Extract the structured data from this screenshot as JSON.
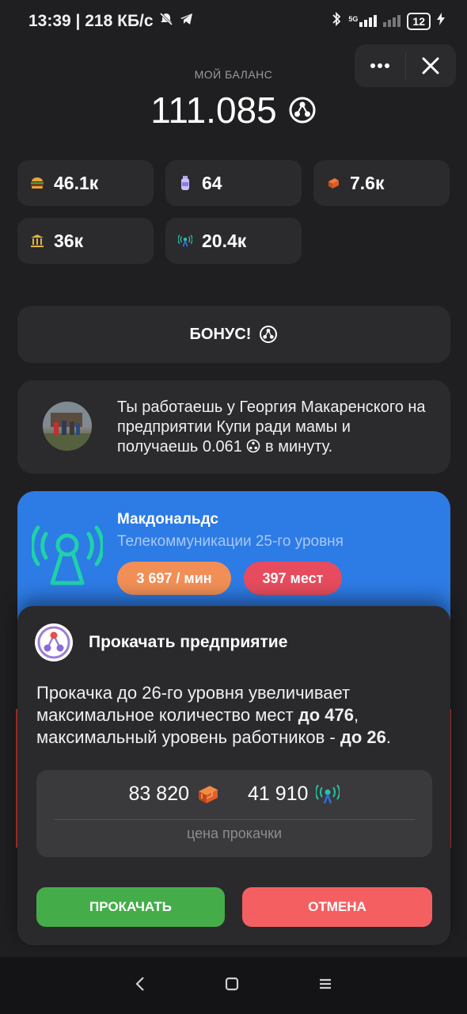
{
  "status_bar": {
    "time_speed": "13:39 | 218 КБ/с",
    "network": "5G",
    "battery": "12"
  },
  "balance": {
    "label": "МОЙ БАЛАНС",
    "value": "111.085"
  },
  "resources": [
    {
      "icon": "burger-icon",
      "value": "46.1к"
    },
    {
      "icon": "bottle-icon",
      "value": "64"
    },
    {
      "icon": "brick-icon",
      "value": "7.6к"
    },
    {
      "icon": "bank-icon",
      "value": "36к"
    },
    {
      "icon": "antenna-icon",
      "value": "20.4к"
    }
  ],
  "bonus": {
    "label": "БОНУС!"
  },
  "work": {
    "text": "Ты работаешь у Георгия Макаренского на предприятии Купи ради мамы и получаешь 0.061",
    "suffix": "в минуту."
  },
  "company": {
    "name": "Макдональдс",
    "subtitle": "Телекоммуникации 25-го уровня",
    "rate": "3 697 / мин",
    "seats": "397 мест"
  },
  "modal": {
    "title": "Прокачать предприятие",
    "desc_part1": "Прокачка до 26-го уровня увеличивает максимальное количество мест ",
    "desc_bold1": "до 476",
    "desc_part2": ", максимальный уровень работников - ",
    "desc_bold2": "до 26",
    "desc_part3": ".",
    "price_bricks": "83 820",
    "price_antennas": "41 910",
    "price_label": "цена прокачки",
    "upgrade_label": "ПРОКАЧАТЬ",
    "cancel_label": "ОТМЕНА"
  },
  "colors": {
    "background": "#1f1f21",
    "tile": "#2b2b2d",
    "company_card": "#2d7be5",
    "upgrade": "#44ad4a",
    "cancel": "#f46062",
    "rate_pill": "#f28f56",
    "seats_pill": "#e74c5e"
  }
}
